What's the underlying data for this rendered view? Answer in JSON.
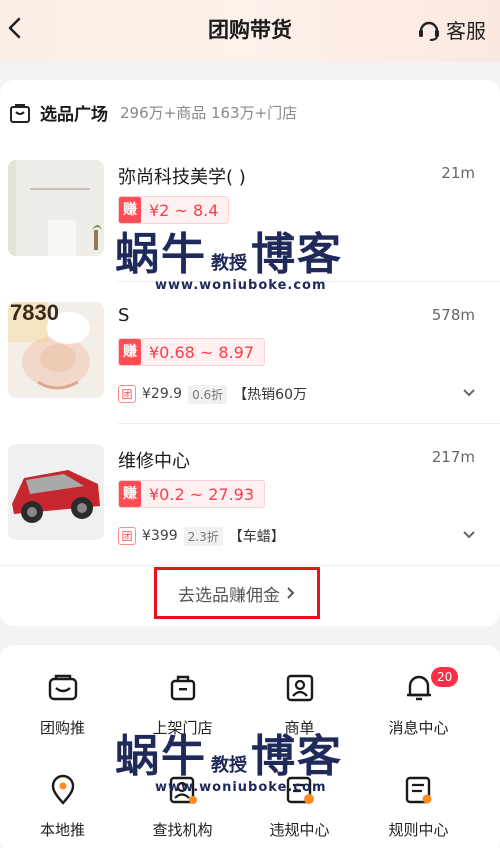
{
  "nav": {
    "title": "团购带货",
    "service_label": "客服"
  },
  "plaza": {
    "title": "选品广场",
    "stats": "296万+商品 163万+门店"
  },
  "items": [
    {
      "name": "弥尚科技美学(                )",
      "distance": "21m",
      "earn_tag": "赚",
      "earn_range": "¥2 ~ 8.4",
      "price": "",
      "discount": "",
      "tag": ""
    },
    {
      "name": "S",
      "distance": "578m",
      "earn_tag": "赚",
      "earn_range": "¥0.68 ~ 8.97",
      "price": "¥29.9",
      "discount": "0.6折",
      "tag": "【热销60万"
    },
    {
      "name": "维修中心",
      "distance": "217m",
      "earn_tag": "赚",
      "earn_range": "¥0.2 ~ 27.93",
      "price": "¥399",
      "discount": "2.3折",
      "tag": "【车蜡】"
    }
  ],
  "thumb2_text": "7830",
  "tuan_label": "团",
  "select_button": "去选品赚佣金",
  "grid": [
    {
      "label": "团购推",
      "icon": "promote-icon"
    },
    {
      "label": "上架门店",
      "icon": "bag-icon"
    },
    {
      "label": "商单",
      "icon": "merchant-icon"
    },
    {
      "label": "消息中心",
      "icon": "bell-icon",
      "badge": "20"
    },
    {
      "label": "本地推",
      "icon": "location-pin-icon"
    },
    {
      "label": "查找机构",
      "icon": "find-org-icon"
    },
    {
      "label": "违规中心",
      "icon": "violation-icon"
    },
    {
      "label": "规则中心",
      "icon": "rules-icon"
    }
  ],
  "watermark": {
    "big1": "蜗牛",
    "small": "教授",
    "big2": "博客",
    "url": "www.woniuboke.com"
  },
  "colors": {
    "accent": "#ff4d55",
    "highlight_border": "#e3141c",
    "icon": "#1a1a1a"
  }
}
